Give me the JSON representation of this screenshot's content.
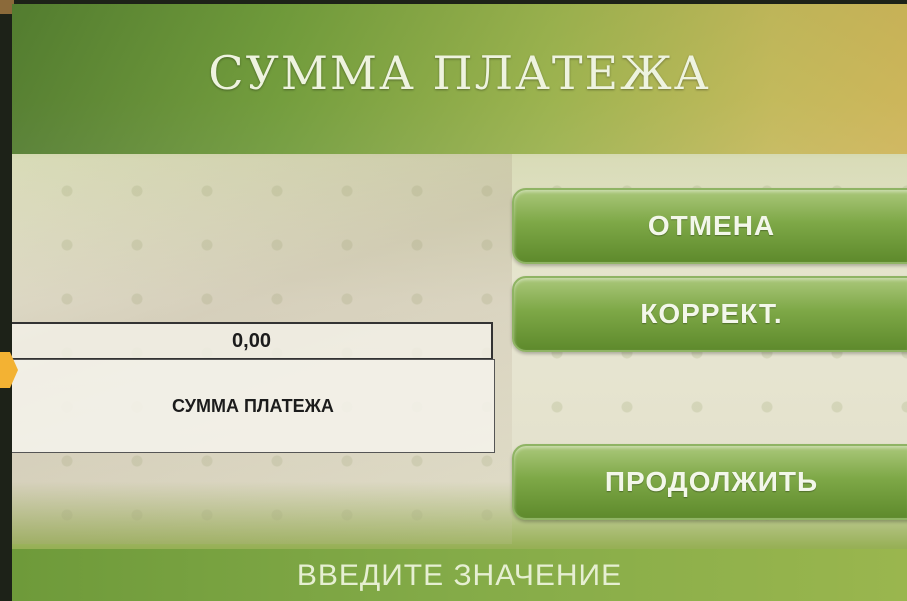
{
  "header": {
    "title": "СУММА ПЛАТЕЖА"
  },
  "amount": {
    "value": "0,00",
    "label": "СУММА ПЛАТЕЖА"
  },
  "buttons": {
    "cancel": "ОТМЕНА",
    "correct": "КОРРЕКТ.",
    "continue": "ПРОДОЛЖИТЬ"
  },
  "footer": {
    "prompt": "ВВЕДИТЕ ЗНАЧЕНИЕ"
  },
  "colors": {
    "button_green": "#7ea847",
    "header_green": "#6e9a3a",
    "panel_cream": "#e8e6d2",
    "indicator_orange": "#f3b233"
  },
  "icons": {
    "side_indicator": "arrow-right-icon"
  }
}
